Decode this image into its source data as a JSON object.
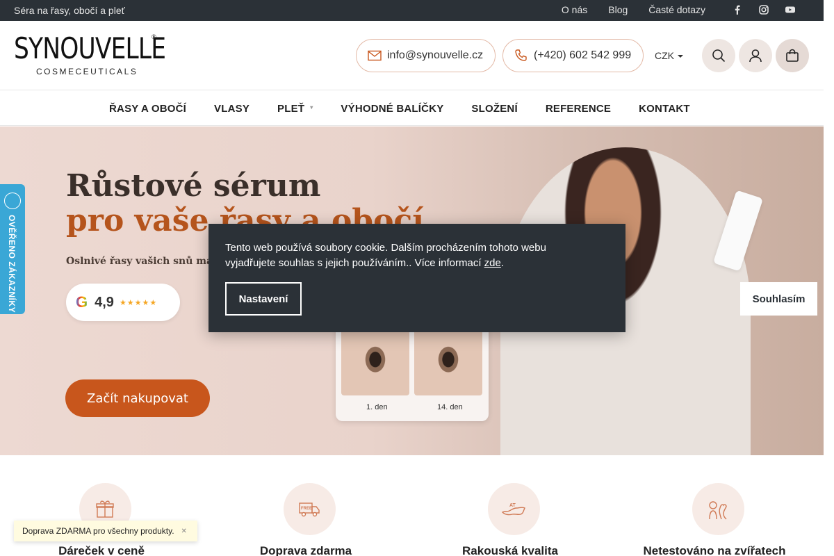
{
  "topbar": {
    "tagline": "Séra na řasy, obočí a pleť",
    "links": [
      "O nás",
      "Blog",
      "Časté dotazy"
    ],
    "social": [
      "facebook-icon",
      "instagram-icon",
      "youtube-icon"
    ]
  },
  "header": {
    "logo_brand": "SYNOUVELLE",
    "logo_sub": "COSMECEUTICALS",
    "email": "info@synouvelle.cz",
    "phone": "(+420) 602 542 999",
    "currency": "CZK"
  },
  "nav": {
    "items": [
      "ŘASY A OBOČÍ",
      "VLASY",
      "PLEŤ",
      "VÝHODNÉ BALÍČKY",
      "SLOŽENÍ",
      "REFERENCE",
      "KONTAKT"
    ]
  },
  "hero": {
    "title_line1": "Růstové sérum",
    "title_line2": "pro vaše řasy a obočí",
    "lead": "Oslnivé řasy vašich snů máte",
    "rating_score": "4,9",
    "rating_stars": 5,
    "before_label": "1. den",
    "after_label": "14. den",
    "cta": "Začít nakupovat"
  },
  "verified_badge": "OVĚŘENO ZÁKAZNÍKY",
  "cookie": {
    "text": "Tento web používá soubory cookie. Dalším procházením tohoto webu vyjadřujete souhlas s jejich používáním.. Více informací ",
    "link": "zde",
    "link_suffix": ".",
    "settings": "Nastavení",
    "accept": "Souhlasím"
  },
  "features": [
    "Dáreček v ceně",
    "Doprava zdarma",
    "Rakouská kvalita",
    "Netestováno na zvířatech"
  ],
  "toast": "Doprava ZDARMA pro všechny produkty.",
  "colors": {
    "accent": "#c8561c",
    "dark": "#2b3137",
    "pill_border": "#e3b9a6",
    "verified": "#3aa7d6"
  }
}
